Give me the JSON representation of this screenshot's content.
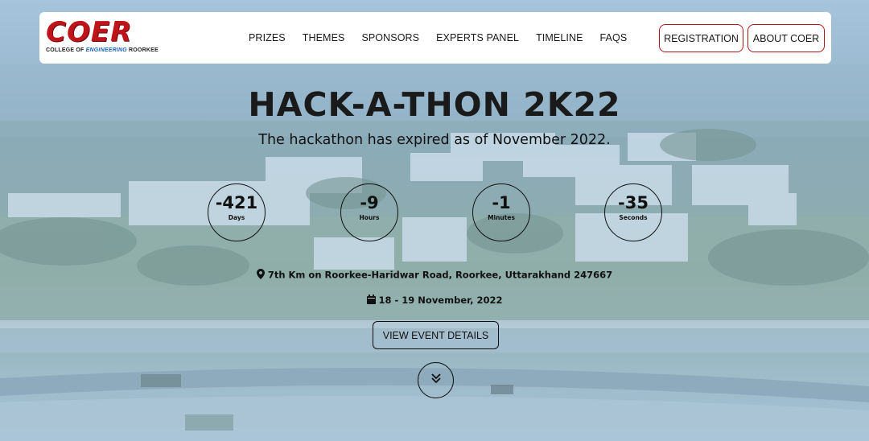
{
  "logo": {
    "main": "COER",
    "sub_prefix": "COLLEGE OF",
    "sub_highlight": "ENGINEERING",
    "sub_suffix": "ROORKEE"
  },
  "nav": {
    "links": [
      "PRIZES",
      "THEMES",
      "SPONSORS",
      "EXPERTS PANEL",
      "TIMELINE",
      "FAQS"
    ],
    "register_label": "REGISTRATION",
    "about_label": "ABOUT COER"
  },
  "hero": {
    "title": "HACK-A-THON 2K22",
    "subtitle": "The hackathon has expired as of November 2022."
  },
  "countdown": [
    {
      "value": "-421",
      "label": "Days"
    },
    {
      "value": "-9",
      "label": "Hours"
    },
    {
      "value": "-1",
      "label": "Minutes"
    },
    {
      "value": "-35",
      "label": "Seconds"
    }
  ],
  "event": {
    "location": "7th Km on Roorkee-Haridwar Road, Roorkee, Uttarakhand 247667",
    "dates": "18 - 19 November, 2022",
    "details_button": "VIEW EVENT DETAILS"
  },
  "icons": {
    "location": "map-marker-icon",
    "calendar": "calendar-icon",
    "scroll": "double-chevron-down-icon"
  },
  "colors": {
    "brand_red": "#c0141b",
    "brand_blue": "#1f63b8",
    "text_dark": "#111111",
    "navbar_bg": "#ffffff"
  }
}
